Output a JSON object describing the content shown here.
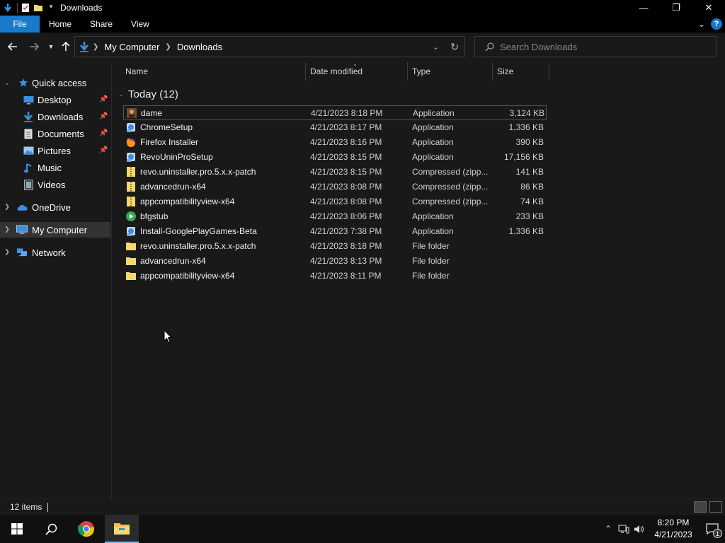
{
  "window": {
    "title": "Downloads",
    "controls": {
      "minimize": "—",
      "restore": "❐",
      "close": "✕"
    }
  },
  "ribbon": {
    "tabs": [
      "File",
      "Home",
      "Share",
      "View"
    ],
    "help": "?"
  },
  "address": {
    "crumbs": [
      "My Computer",
      "Downloads"
    ],
    "search_placeholder": "Search Downloads"
  },
  "nav": {
    "items": [
      {
        "label": "Quick access",
        "icon": "star-icon"
      },
      {
        "label": "Desktop",
        "icon": "desktop-icon",
        "pinned": true
      },
      {
        "label": "Downloads",
        "icon": "download-icon",
        "pinned": true
      },
      {
        "label": "Documents",
        "icon": "documents-icon",
        "pinned": true
      },
      {
        "label": "Pictures",
        "icon": "pictures-icon",
        "pinned": true
      },
      {
        "label": "Music",
        "icon": "music-icon"
      },
      {
        "label": "Videos",
        "icon": "videos-icon"
      },
      {
        "label": "OneDrive",
        "icon": "cloud-icon"
      },
      {
        "label": "My Computer",
        "icon": "computer-icon",
        "selected": true
      },
      {
        "label": "Network",
        "icon": "network-icon"
      }
    ]
  },
  "columns": [
    "Name",
    "Date modified",
    "Type",
    "Size"
  ],
  "group": {
    "label": "Today (12)"
  },
  "files": [
    {
      "name": "dame",
      "date": "4/21/2023 8:18 PM",
      "type": "Application",
      "size": "3,124 KB",
      "icon": "app-dame-icon"
    },
    {
      "name": "ChromeSetup",
      "date": "4/21/2023 8:17 PM",
      "type": "Application",
      "size": "1,336 KB",
      "icon": "installer-icon"
    },
    {
      "name": "Firefox Installer",
      "date": "4/21/2023 8:16 PM",
      "type": "Application",
      "size": "390 KB",
      "icon": "firefox-icon"
    },
    {
      "name": "RevoUninProSetup",
      "date": "4/21/2023 8:15 PM",
      "type": "Application",
      "size": "17,156 KB",
      "icon": "installer-icon"
    },
    {
      "name": "revo.uninstaller.pro.5.x.x-patch",
      "date": "4/21/2023 8:15 PM",
      "type": "Compressed (zipp...",
      "size": "141 KB",
      "icon": "zip-folder-icon"
    },
    {
      "name": "advancedrun-x64",
      "date": "4/21/2023 8:08 PM",
      "type": "Compressed (zipp...",
      "size": "86 KB",
      "icon": "zip-folder-icon"
    },
    {
      "name": "appcompatibilityview-x64",
      "date": "4/21/2023 8:08 PM",
      "type": "Compressed (zipp...",
      "size": "74 KB",
      "icon": "zip-folder-icon"
    },
    {
      "name": "bfgstub",
      "date": "4/21/2023 8:06 PM",
      "type": "Application",
      "size": "233 KB",
      "icon": "play-app-icon"
    },
    {
      "name": "Install-GooglePlayGames-Beta",
      "date": "4/21/2023 7:38 PM",
      "type": "Application",
      "size": "1,336 KB",
      "icon": "installer-icon"
    },
    {
      "name": "revo.uninstaller.pro.5.x.x-patch",
      "date": "4/21/2023 8:18 PM",
      "type": "File folder",
      "size": "",
      "icon": "folder-icon"
    },
    {
      "name": "advancedrun-x64",
      "date": "4/21/2023 8:13 PM",
      "type": "File folder",
      "size": "",
      "icon": "folder-icon"
    },
    {
      "name": "appcompatibilityview-x64",
      "date": "4/21/2023 8:11 PM",
      "type": "File folder",
      "size": "",
      "icon": "folder-icon"
    }
  ],
  "status": {
    "items": "12 items"
  },
  "taskbar": {
    "time": "8:20 PM",
    "date": "4/21/2023",
    "notifications": "1"
  }
}
